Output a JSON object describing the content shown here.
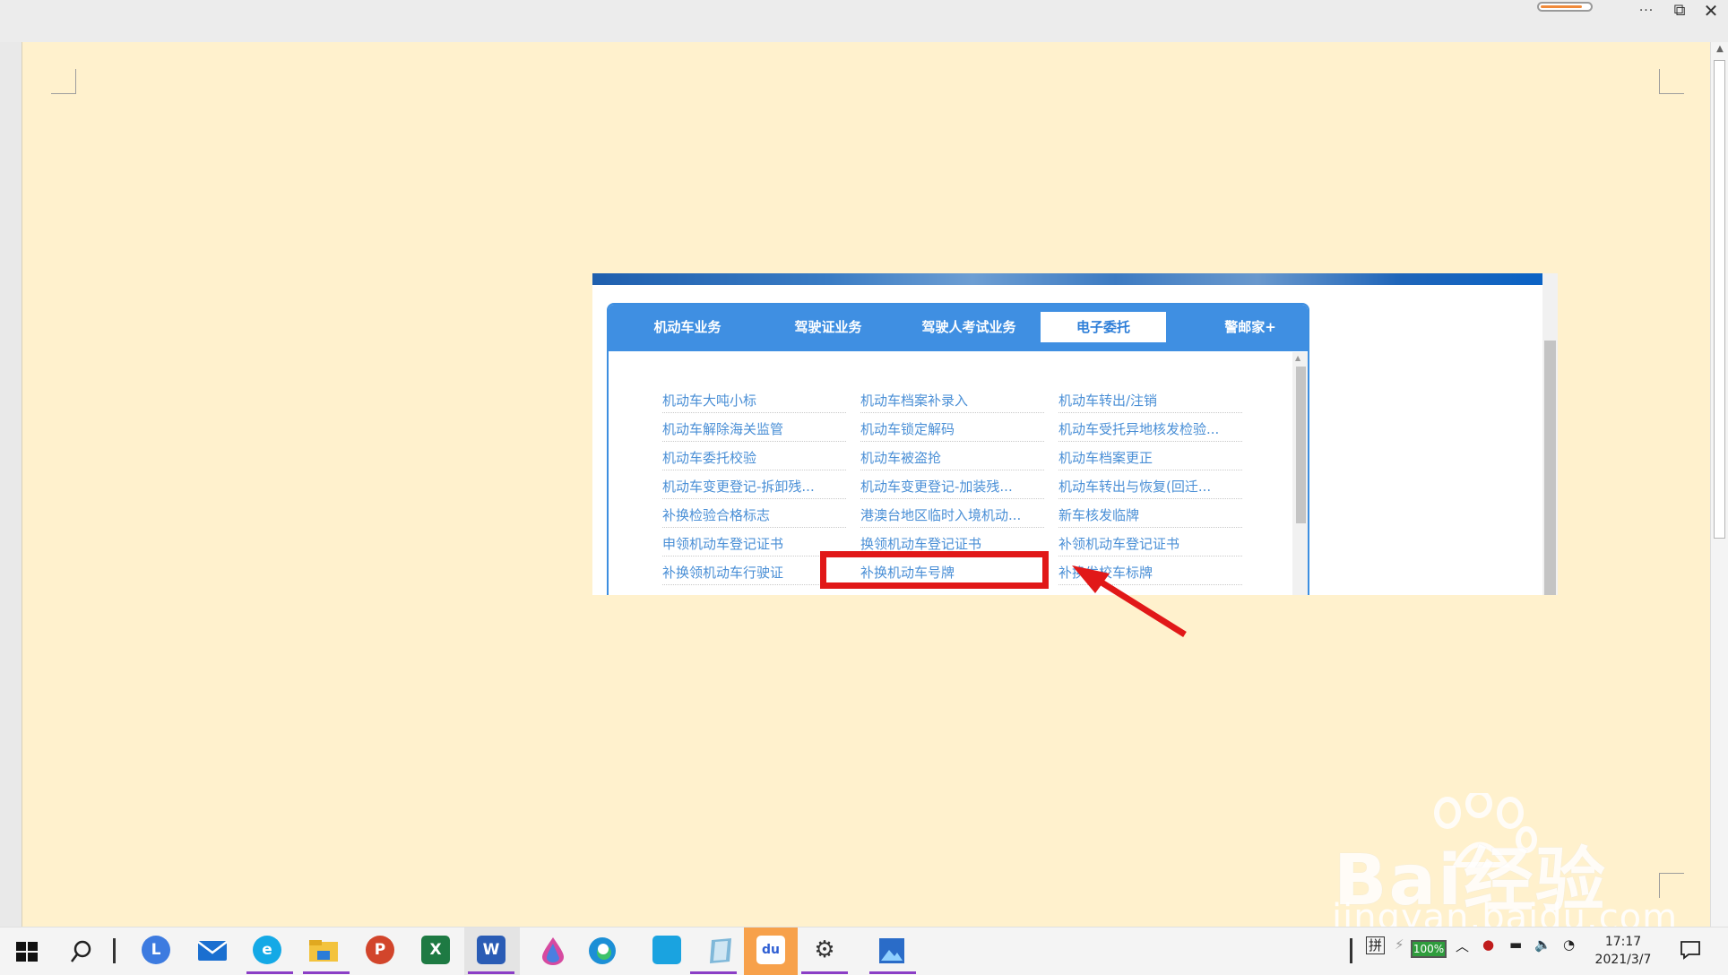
{
  "titlebar": {
    "more": "···",
    "restore": "⧉",
    "close": "✕",
    "progress_fraction": 0.85
  },
  "tabs": [
    {
      "label": "机动车业务",
      "active": false
    },
    {
      "label": "驾驶证业务",
      "active": false
    },
    {
      "label": "驾驶人考试业务",
      "active": false
    },
    {
      "label": "电子委托",
      "active": true
    },
    {
      "label": "警邮家+",
      "active": false
    }
  ],
  "links": [
    [
      "机动车大吨小标",
      "机动车档案补录入",
      "机动车转出/注销"
    ],
    [
      "机动车解除海关监管",
      "机动车锁定解码",
      "机动车受托异地核发检验..."
    ],
    [
      "机动车委托校验",
      "机动车被盗抢",
      "机动车档案更正"
    ],
    [
      "机动车变更登记-拆卸残...",
      "机动车变更登记-加装残...",
      "机动车转出与恢复(回迁..."
    ],
    [
      "补换检验合格标志",
      "港澳台地区临时入境机动...",
      "新车核发临牌"
    ],
    [
      "申领机动车登记证书",
      "换领机动车登记证书",
      "补领机动车登记证书"
    ],
    [
      "补换领机动车行驶证",
      "补换机动车号牌",
      "补换发校车标牌"
    ]
  ],
  "watermark": {
    "brand": "Bai经验",
    "url": "jingyan.baidu.com"
  },
  "taskbar": {
    "apps": [
      {
        "name": "start-icon"
      },
      {
        "name": "search-icon"
      },
      {
        "name": "lenovo-icon",
        "glyph": "L"
      },
      {
        "name": "mail-icon"
      },
      {
        "name": "ie-icon",
        "glyph": "e"
      },
      {
        "name": "file-explorer-icon"
      },
      {
        "name": "powerpoint-icon",
        "glyph": "P"
      },
      {
        "name": "excel-icon",
        "glyph": "X"
      },
      {
        "name": "word-icon",
        "glyph": "W"
      },
      {
        "name": "drop-app-icon"
      },
      {
        "name": "edge-icon"
      },
      {
        "name": "screen-app-icon"
      },
      {
        "name": "notes-app-icon"
      },
      {
        "name": "baidu-icon",
        "glyph": "du"
      },
      {
        "name": "settings-icon",
        "glyph": "⚙"
      },
      {
        "name": "photos-icon"
      }
    ],
    "tray": {
      "ime": "拼",
      "battery": "100%",
      "time": "17:17",
      "date": "2021/3/7"
    }
  }
}
